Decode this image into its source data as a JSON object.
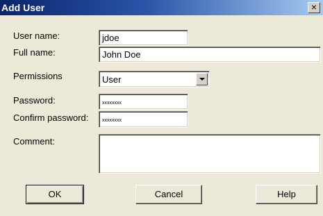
{
  "window": {
    "title": "Add User",
    "close_glyph": "×"
  },
  "form": {
    "username": {
      "label": "User name:",
      "value": "jdoe"
    },
    "fullname": {
      "label": "Full name:",
      "value": "John Doe"
    },
    "permissions": {
      "label": "Permissions",
      "value": "User"
    },
    "password": {
      "label": "Password:",
      "value": "xxxxxxxx"
    },
    "confirm": {
      "label": "Confirm password:",
      "value": "xxxxxxxx"
    },
    "comment": {
      "label": "Comment:",
      "value": ""
    }
  },
  "buttons": {
    "ok": "OK",
    "cancel": "Cancel",
    "help": "Help"
  }
}
